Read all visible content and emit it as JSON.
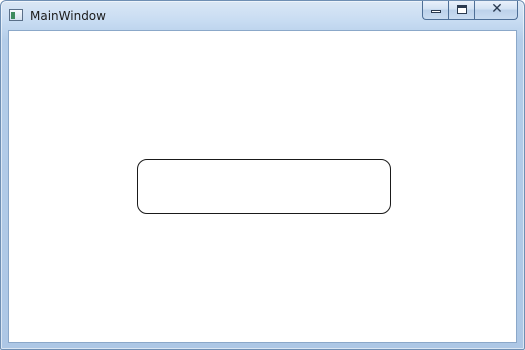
{
  "window": {
    "title": "MainWindow",
    "icon": "app-window-icon"
  },
  "caption_buttons": {
    "minimize_icon": "minimize-icon",
    "maximize_icon": "maximize-icon",
    "close_icon": "close-icon",
    "close_glyph": "✕"
  },
  "colors": {
    "frame": "#adc7e5",
    "client_background": "#ffffff",
    "box_border": "#1a1a1a"
  }
}
